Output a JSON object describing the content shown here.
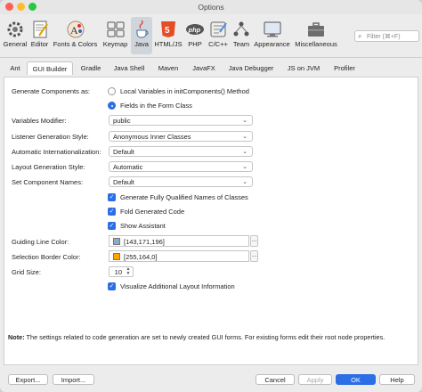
{
  "window": {
    "title": "Options"
  },
  "categories": [
    {
      "label": "General",
      "icon": "general-icon"
    },
    {
      "label": "Editor",
      "icon": "editor-icon"
    },
    {
      "label": "Fonts & Colors",
      "icon": "fonts-colors-icon"
    },
    {
      "label": "Keymap",
      "icon": "keymap-icon"
    },
    {
      "label": "Java",
      "icon": "java-icon",
      "selected": true
    },
    {
      "label": "HTML/JS",
      "icon": "html5-icon"
    },
    {
      "label": "PHP",
      "icon": "php-icon"
    },
    {
      "label": "C/C++",
      "icon": "cpp-icon"
    },
    {
      "label": "Team",
      "icon": "team-icon"
    },
    {
      "label": "Appearance",
      "icon": "appearance-icon"
    },
    {
      "label": "Miscellaneous",
      "icon": "miscellaneous-icon"
    }
  ],
  "filter": {
    "placeholder": "Filter (⌘+F)"
  },
  "tabs": [
    {
      "label": "Ant"
    },
    {
      "label": "GUI Builder",
      "active": true
    },
    {
      "label": "Gradle"
    },
    {
      "label": "Java Shell"
    },
    {
      "label": "Maven"
    },
    {
      "label": "JavaFX"
    },
    {
      "label": "Java Debugger"
    },
    {
      "label": "JS on JVM"
    },
    {
      "label": "Profiler"
    }
  ],
  "form": {
    "generate_components": {
      "label": "Generate Components as:",
      "options": [
        {
          "label": "Local Variables in initComponents() Method",
          "selected": false
        },
        {
          "label": "Fields in the Form Class",
          "selected": true
        }
      ]
    },
    "variables_modifier": {
      "label": "Variables Modifier:",
      "value": "public"
    },
    "listener_style": {
      "label": "Listener Generation Style:",
      "value": "Anonymous Inner Classes"
    },
    "automatic_i18n": {
      "label": "Automatic Internationalization:",
      "value": "Default"
    },
    "layout_style": {
      "label": "Layout Generation Style:",
      "value": "Automatic"
    },
    "component_names": {
      "label": "Set Component Names:",
      "value": "Default"
    },
    "checkboxes": [
      {
        "label": "Generate Fully Qualified Names of Classes",
        "checked": true
      },
      {
        "label": "Fold Generated Code",
        "checked": true
      },
      {
        "label": "Show Assistant",
        "checked": true
      }
    ],
    "guiding_line_color": {
      "label": "Guiding Line Color:",
      "value": "[143,171,196]",
      "color": "#8fabc4"
    },
    "selection_border_color": {
      "label": "Selection Border Color:",
      "value": "[255,164,0]",
      "color": "#ffa400"
    },
    "grid_size": {
      "label": "Grid Size:",
      "value": "10"
    },
    "visualize_layout": {
      "label": "Visualize Additional Layout Information",
      "checked": true
    }
  },
  "note": {
    "bold": "Note:",
    "text": " The settings related to code generation are set to newly created GUI forms. For existing forms edit their root node properties."
  },
  "buttons": {
    "export": "Export...",
    "import": "Import...",
    "cancel": "Cancel",
    "apply": "Apply",
    "ok": "OK",
    "help": "Help"
  },
  "colors": {
    "accent": "#2b6ee6",
    "selected_category": "#d0d4db"
  }
}
